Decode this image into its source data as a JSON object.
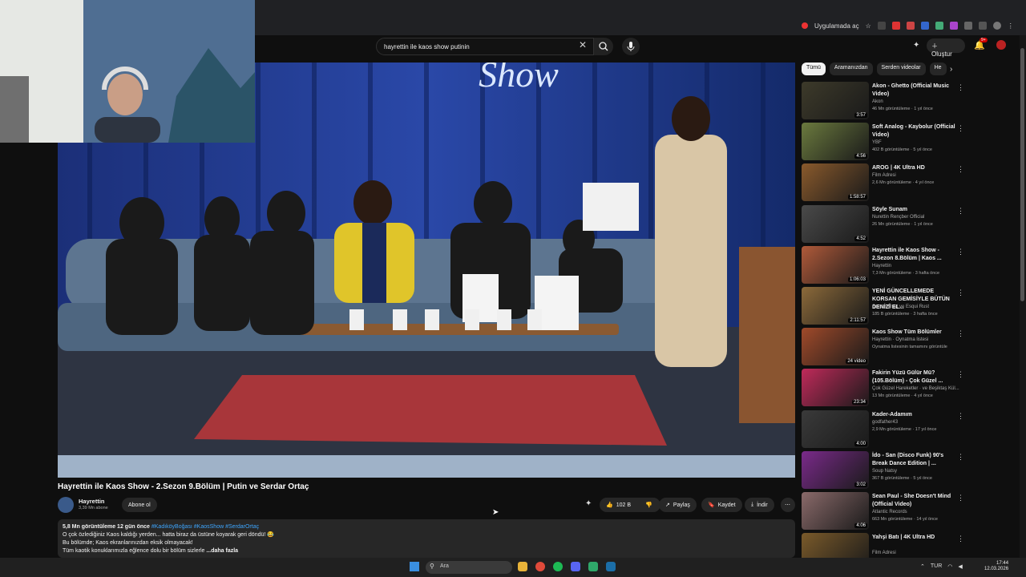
{
  "browser": {
    "open_in_app": "Uygulamada aç"
  },
  "youtube": {
    "search": {
      "query": "hayrettin ile kaos show putinin"
    },
    "create_label": "Oluştur",
    "notifications_badge": "9+"
  },
  "video": {
    "neon_sign": "Show",
    "title": "Hayrettin ile Kaos Show - 2.Sezon 9.Bölüm | Putin ve Serdar Ortaç",
    "channel": "Hayrettin",
    "subscribers": "3,39 Mn abone",
    "subscribe_label": "Abone ol",
    "likes": "102 B",
    "share_label": "Paylaş",
    "save_label": "Kaydet",
    "download_label": "İndir",
    "description": {
      "stats": "5,8 Mn görüntüleme  12 gün önce",
      "hashtags": "#KadıköyBoğası #KaosShow #SerdarOrtaç",
      "line1": "O çok özlediğiniz Kaos kaldığı yerden... hatta biraz da üstüne koyarak geri döndü! 😂",
      "line2": "Bu bölümde; Kaos ekranlarınızdan eksik olmayacak!",
      "line3": "Tüm kaotik konuklarımızla eğlence dolu bir bölüm sizlerle",
      "more": "...daha fazla"
    }
  },
  "chips": [
    {
      "label": "Tümü",
      "active": true
    },
    {
      "label": "Aramanızdan",
      "active": false
    },
    {
      "label": "Serden videolar",
      "active": false
    },
    {
      "label": "He",
      "active": false
    }
  ],
  "recommendations": [
    {
      "title": "Akon - Ghetto (Official Music Video)",
      "channel": "Akon",
      "meta": "46 Mn görüntüleme · 1 yıl önce",
      "duration": "3:57",
      "color": "#3d3a2a"
    },
    {
      "title": "Soft Analog - Kaybolur (Official Video)",
      "channel": "YBF",
      "meta": "402 B görüntüleme · 5 yıl önce",
      "duration": "4:56",
      "color": "#6b7a3e"
    },
    {
      "title": "AROG | 4K Ultra HD",
      "channel": "Film Adresi",
      "meta": "2,6 Mn görüntüleme · 4 yıl önce",
      "duration": "1:58:57",
      "color": "#8a5a2c"
    },
    {
      "title": "Söyle Sunam",
      "channel": "Nurettin Rençber Official",
      "meta": "26 Mn görüntüleme · 1 yıl önce",
      "duration": "4:52",
      "color": "#4a4a4a"
    },
    {
      "title": "Hayrettin ile Kaos Show - 2.Sezon 8.Bölüm | Kaos ...",
      "channel": "Hayrettin",
      "meta": "7,3 Mn görüntüleme · 3 hafta önce",
      "duration": "1:06:03",
      "color": "#b05a3a"
    },
    {
      "title": "YENİ GÜNCELLEMEDE KORSAN GEMİSİYLE BÜTÜN DENİZİ EL...",
      "channel": "Sensei Rust ve Esqui Rust",
      "meta": "185 B görüntüleme · 3 hafta önce",
      "duration": "2:11:57",
      "color": "#8c6a3a"
    },
    {
      "title": "Kaos Show Tüm Bölümler",
      "channel": "Hayrettin · Oynatma listesi",
      "meta": "Oynatma listesinin tamamını görüntüle",
      "duration": "24 video",
      "color": "#a04a2a"
    },
    {
      "title": "Fakirin Yüzü Gülür Mü? (105.Bölüm) - Çok Güzel ...",
      "channel": "Çok Güzel Hareketler · ve Beşiktaş Kül...",
      "meta": "13 Mn görüntüleme · 4 yıl önce",
      "duration": "23:34",
      "color": "#c02a5a"
    },
    {
      "title": "Kader-Adamım",
      "channel": "godfather43",
      "meta": "2,9 Mn görüntüleme · 17 yıl önce",
      "duration": "4:00",
      "color": "#3a3a3a"
    },
    {
      "title": "İdo - San (Disco Funk) 90's Break Dance Edition | ...",
      "channel": "Soup Natsy",
      "meta": "367 B görüntüleme · 5 yıl önce",
      "duration": "3:02",
      "color": "#7a2a8a"
    },
    {
      "title": "Sean Paul - She Doesn't Mind (Official Video)",
      "channel": "Atlantic Records",
      "meta": "663 Mn görüntüleme · 14 yıl önce",
      "duration": "4:06",
      "color": "#8a6a6a"
    },
    {
      "title": "Yahşi Batı | 4K Ultra HD",
      "channel": "Film Adresi",
      "meta": "",
      "duration": "",
      "color": "#7a5a2a"
    }
  ],
  "taskbar": {
    "search_placeholder": "Ara",
    "lang": "TUR",
    "time": "17:44",
    "date": "12.03.2026"
  }
}
